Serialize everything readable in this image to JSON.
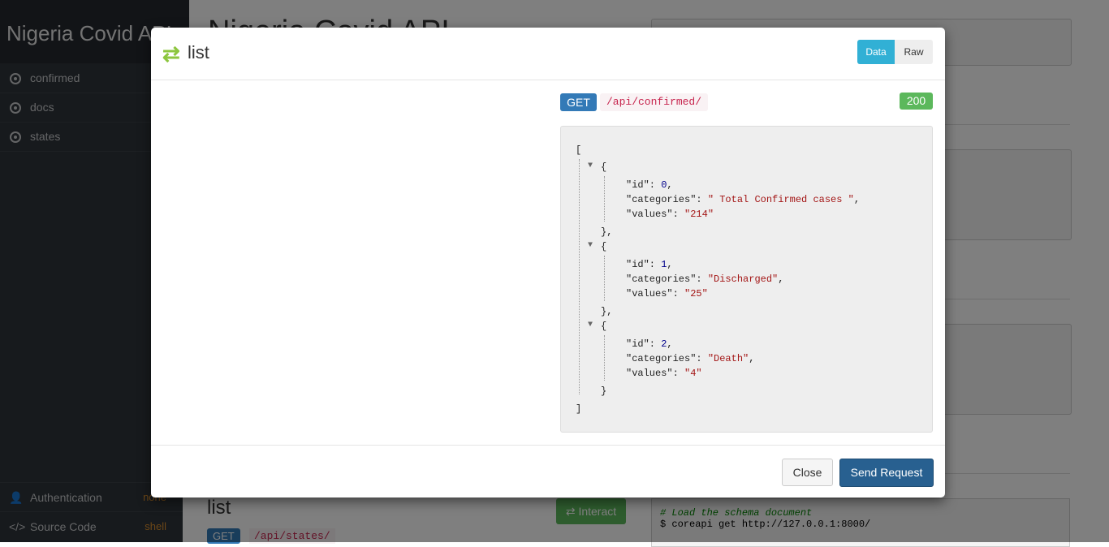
{
  "sidebar": {
    "brand": "Nigeria Covid API",
    "items": [
      {
        "label": "confirmed"
      },
      {
        "label": "docs"
      },
      {
        "label": "states"
      }
    ],
    "footer": [
      {
        "label": "Authentication",
        "value": "none"
      },
      {
        "label": "Source Code",
        "value": "shell"
      }
    ]
  },
  "main": {
    "title": "Nigeria Covid API",
    "list_heading": "list",
    "interact_label": "Interact",
    "method": "GET",
    "path": "/api/states/",
    "code_comment": "# Load the schema document",
    "code_command": "$ coreapi get http://127.0.0.1:8000/"
  },
  "modal": {
    "title": "list",
    "tabs": [
      "Data",
      "Raw"
    ],
    "method": "GET",
    "path": "/api/confirmed/",
    "status": "200",
    "close_label": "Close",
    "send_label": "Send Request",
    "response": [
      {
        "id": "0",
        "categories": "\" Total Confirmed cases \"",
        "values": "\"214\""
      },
      {
        "id": "1",
        "categories": "\"Discharged\"",
        "values": "\"25\""
      },
      {
        "id": "2",
        "categories": "\"Death\"",
        "values": "\"4\""
      }
    ]
  },
  "colors": {
    "sidebar_bg": "#2f343b",
    "accent_info": "#31b0d5",
    "get_badge": "#337ab7",
    "status_ok": "#5cb85c",
    "send_button": "#286090",
    "interact_icon": "#8dc63f"
  }
}
